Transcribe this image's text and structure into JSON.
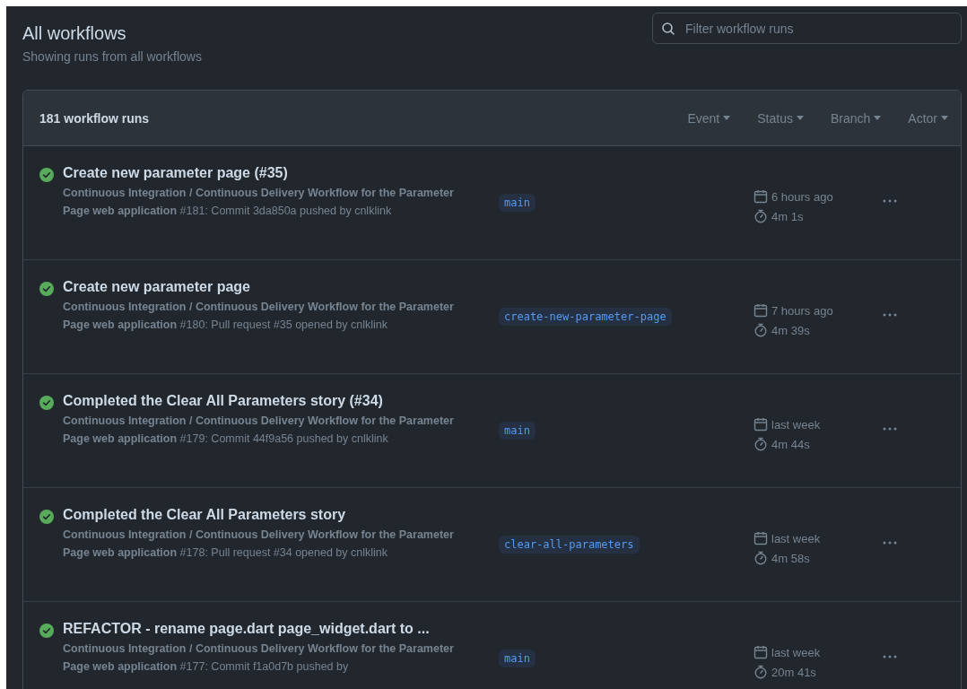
{
  "header": {
    "title": "All workflows",
    "subtitle": "Showing runs from all workflows"
  },
  "search": {
    "placeholder": "Filter workflow runs"
  },
  "runs_box": {
    "count": "181 workflow runs",
    "filters": [
      {
        "label": "Event"
      },
      {
        "label": "Status"
      },
      {
        "label": "Branch"
      },
      {
        "label": "Actor"
      }
    ]
  },
  "runs": [
    {
      "kind": "success",
      "title": "Create new parameter page (#35)",
      "description": "**Continuous Integration / Continuous Delivery Workflow for the Parameter Page web application** #181: Commit 3da850a pushed by cnlklink",
      "branch": "main",
      "when": "6 hours ago",
      "duration": "4m 1s"
    },
    {
      "kind": "success",
      "title": "Create new parameter page",
      "description": "**Continuous Integration / Continuous Delivery Workflow for the Parameter Page web application** #180: Pull request #35 opened by cnlklink",
      "branch": "create-new-parameter-page",
      "when": "7 hours ago",
      "duration": "4m 39s"
    },
    {
      "kind": "success",
      "title": "Completed the Clear All Parameters story (#34)",
      "description": "**Continuous Integration / Continuous Delivery Workflow for the Parameter Page web application** #179: Commit 44f9a56 pushed by cnlklink",
      "branch": "main",
      "when": "last week",
      "duration": "4m 44s"
    },
    {
      "kind": "success",
      "title": "Completed the Clear All Parameters story",
      "description": "**Continuous Integration / Continuous Delivery Workflow for the Parameter Page web application** #178: Pull request #34 opened by cnlklink",
      "branch": "clear-all-parameters",
      "when": "last week",
      "duration": "4m 58s"
    },
    {
      "kind": "success",
      "title": "REFACTOR - rename page.dart page_widget.dart to ...",
      "description": "**Continuous Integration / Continuous Delivery Workflow for the Parameter Page web application** #177: Commit f1a0d7b pushed by",
      "branch": "main",
      "when": "last week",
      "duration": "20m 41s"
    }
  ]
}
